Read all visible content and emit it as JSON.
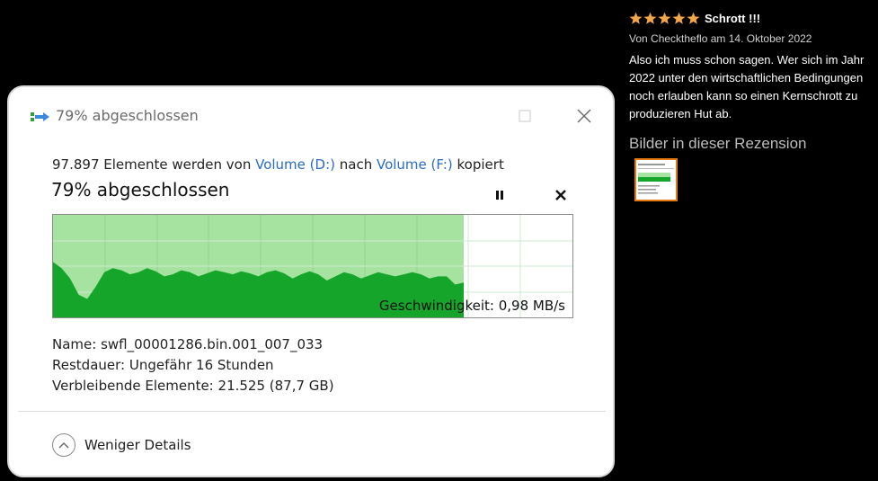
{
  "dialog": {
    "title": "79% abgeschlossen",
    "subtitle": {
      "prefix": "97.897 Elemente werden von ",
      "source": "Volume (D:)",
      "middle": " nach ",
      "target": "Volume (F:)",
      "suffix": " kopiert"
    },
    "status": "79% abgeschlossen",
    "progress": 0.79,
    "speed_label": "Geschwindigkeit: 0,98 MB/s",
    "name_label": "Name:",
    "name_value": "swfl_00001286.bin.001_007_033",
    "remaining_label": "Restdauer:",
    "remaining_value": "Ungefähr 16 Stunden",
    "items_left_label": "Verbleibende Elemente:",
    "items_left_value": "21.525 (87,7 GB)",
    "details_toggle": "Weniger Details",
    "colors": {
      "progress_fill": "#a6e3a0",
      "speed_fill": "#14a52a",
      "link": "#2b6cc4"
    }
  },
  "review": {
    "rating": 5,
    "title": "Schrott !!!",
    "byline": "Von Checktheflo am 14. Oktober 2022",
    "body": "Also ich muss schon sagen. Wer sich im Jahr 2022 unter den wirtschaftlichen Bedingungen noch erlauben kann so einen Kernschrott zu produzieren Hut ab.",
    "images_heading": "Bilder in dieser Rezension",
    "star_color": "#f3a847",
    "thumb_border": "#e47911"
  }
}
